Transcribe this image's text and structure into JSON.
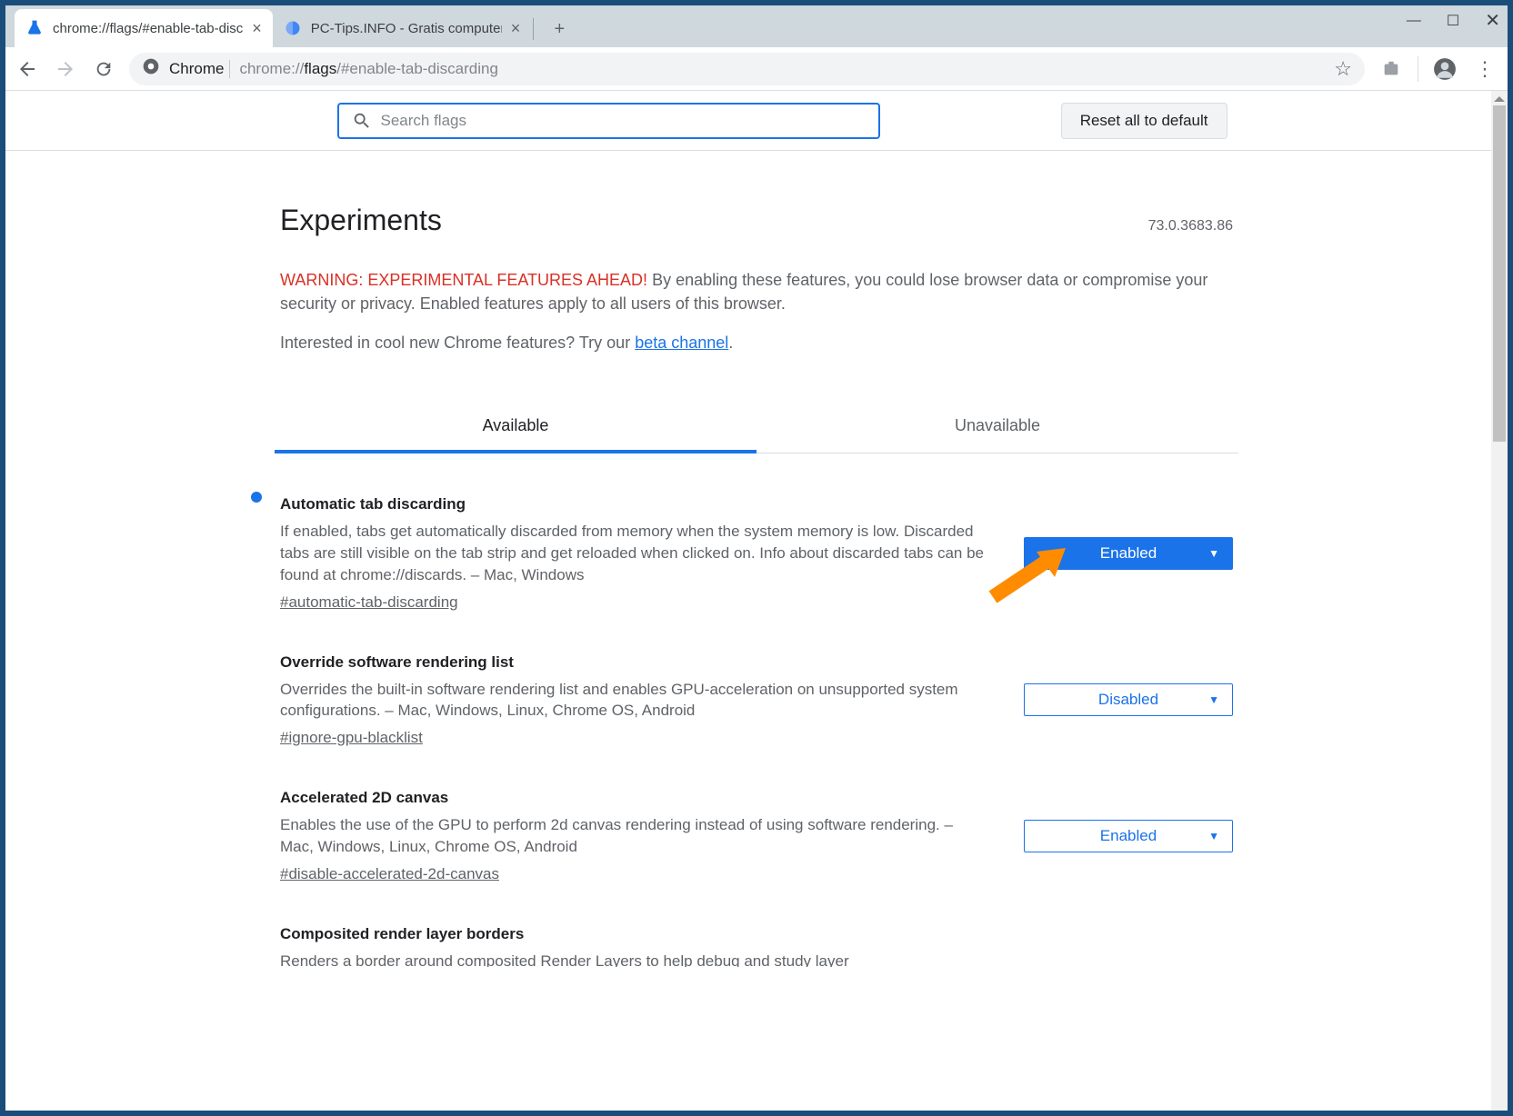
{
  "tabs": [
    {
      "title": "chrome://flags/#enable-tab-disc",
      "active": true,
      "favicon": "flask"
    },
    {
      "title": "PC-Tips.INFO - Gratis computer t",
      "active": false,
      "favicon": "globe"
    }
  ],
  "toolbar": {
    "chrome_label": "Chrome",
    "url_scheme": "chrome://",
    "url_host": "flags",
    "url_rest": "/#enable-tab-discarding"
  },
  "header": {
    "search_placeholder": "Search flags",
    "reset_label": "Reset all to default"
  },
  "page": {
    "title": "Experiments",
    "version": "73.0.3683.86",
    "warning_prefix": "WARNING: EXPERIMENTAL FEATURES AHEAD!",
    "warning_body": "By enabling these features, you could lose browser data or compromise your security or privacy. Enabled features apply to all users of this browser.",
    "beta_text": "Interested in cool new Chrome features? Try our ",
    "beta_link": "beta channel",
    "tab_available": "Available",
    "tab_unavailable": "Unavailable"
  },
  "flags": [
    {
      "title": "Automatic tab discarding",
      "desc": "If enabled, tabs get automatically discarded from memory when the system memory is low. Discarded tabs are still visible on the tab strip and get reloaded when clicked on. Info about discarded tabs can be found at chrome://discards. – Mac, Windows",
      "anchor": "#automatic-tab-discarding",
      "value": "Enabled",
      "highlighted": true,
      "modified": true
    },
    {
      "title": "Override software rendering list",
      "desc": "Overrides the built-in software rendering list and enables GPU-acceleration on unsupported system configurations. – Mac, Windows, Linux, Chrome OS, Android",
      "anchor": "#ignore-gpu-blacklist",
      "value": "Disabled",
      "highlighted": false,
      "modified": false
    },
    {
      "title": "Accelerated 2D canvas",
      "desc": "Enables the use of the GPU to perform 2d canvas rendering instead of using software rendering. – Mac, Windows, Linux, Chrome OS, Android",
      "anchor": "#disable-accelerated-2d-canvas",
      "value": "Enabled",
      "highlighted": false,
      "modified": false
    },
    {
      "title": "Composited render layer borders",
      "desc": "Renders a border around composited Render Layers to help debug and study layer",
      "anchor": "",
      "value": "",
      "highlighted": false,
      "modified": false
    }
  ]
}
